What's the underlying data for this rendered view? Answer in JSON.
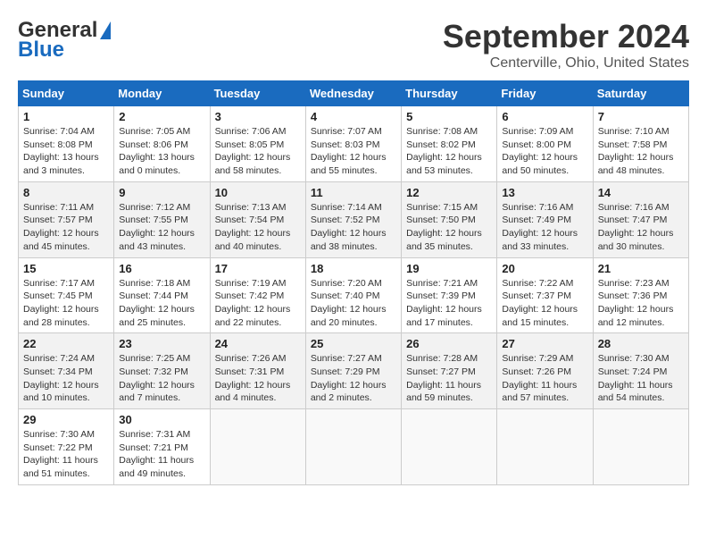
{
  "header": {
    "logo_line1": "General",
    "logo_line2": "Blue",
    "month": "September 2024",
    "location": "Centerville, Ohio, United States"
  },
  "days_of_week": [
    "Sunday",
    "Monday",
    "Tuesday",
    "Wednesday",
    "Thursday",
    "Friday",
    "Saturday"
  ],
  "weeks": [
    [
      {
        "day": "1",
        "sunrise": "Sunrise: 7:04 AM",
        "sunset": "Sunset: 8:08 PM",
        "daylight": "Daylight: 13 hours and 3 minutes."
      },
      {
        "day": "2",
        "sunrise": "Sunrise: 7:05 AM",
        "sunset": "Sunset: 8:06 PM",
        "daylight": "Daylight: 13 hours and 0 minutes."
      },
      {
        "day": "3",
        "sunrise": "Sunrise: 7:06 AM",
        "sunset": "Sunset: 8:05 PM",
        "daylight": "Daylight: 12 hours and 58 minutes."
      },
      {
        "day": "4",
        "sunrise": "Sunrise: 7:07 AM",
        "sunset": "Sunset: 8:03 PM",
        "daylight": "Daylight: 12 hours and 55 minutes."
      },
      {
        "day": "5",
        "sunrise": "Sunrise: 7:08 AM",
        "sunset": "Sunset: 8:02 PM",
        "daylight": "Daylight: 12 hours and 53 minutes."
      },
      {
        "day": "6",
        "sunrise": "Sunrise: 7:09 AM",
        "sunset": "Sunset: 8:00 PM",
        "daylight": "Daylight: 12 hours and 50 minutes."
      },
      {
        "day": "7",
        "sunrise": "Sunrise: 7:10 AM",
        "sunset": "Sunset: 7:58 PM",
        "daylight": "Daylight: 12 hours and 48 minutes."
      }
    ],
    [
      {
        "day": "8",
        "sunrise": "Sunrise: 7:11 AM",
        "sunset": "Sunset: 7:57 PM",
        "daylight": "Daylight: 12 hours and 45 minutes."
      },
      {
        "day": "9",
        "sunrise": "Sunrise: 7:12 AM",
        "sunset": "Sunset: 7:55 PM",
        "daylight": "Daylight: 12 hours and 43 minutes."
      },
      {
        "day": "10",
        "sunrise": "Sunrise: 7:13 AM",
        "sunset": "Sunset: 7:54 PM",
        "daylight": "Daylight: 12 hours and 40 minutes."
      },
      {
        "day": "11",
        "sunrise": "Sunrise: 7:14 AM",
        "sunset": "Sunset: 7:52 PM",
        "daylight": "Daylight: 12 hours and 38 minutes."
      },
      {
        "day": "12",
        "sunrise": "Sunrise: 7:15 AM",
        "sunset": "Sunset: 7:50 PM",
        "daylight": "Daylight: 12 hours and 35 minutes."
      },
      {
        "day": "13",
        "sunrise": "Sunrise: 7:16 AM",
        "sunset": "Sunset: 7:49 PM",
        "daylight": "Daylight: 12 hours and 33 minutes."
      },
      {
        "day": "14",
        "sunrise": "Sunrise: 7:16 AM",
        "sunset": "Sunset: 7:47 PM",
        "daylight": "Daylight: 12 hours and 30 minutes."
      }
    ],
    [
      {
        "day": "15",
        "sunrise": "Sunrise: 7:17 AM",
        "sunset": "Sunset: 7:45 PM",
        "daylight": "Daylight: 12 hours and 28 minutes."
      },
      {
        "day": "16",
        "sunrise": "Sunrise: 7:18 AM",
        "sunset": "Sunset: 7:44 PM",
        "daylight": "Daylight: 12 hours and 25 minutes."
      },
      {
        "day": "17",
        "sunrise": "Sunrise: 7:19 AM",
        "sunset": "Sunset: 7:42 PM",
        "daylight": "Daylight: 12 hours and 22 minutes."
      },
      {
        "day": "18",
        "sunrise": "Sunrise: 7:20 AM",
        "sunset": "Sunset: 7:40 PM",
        "daylight": "Daylight: 12 hours and 20 minutes."
      },
      {
        "day": "19",
        "sunrise": "Sunrise: 7:21 AM",
        "sunset": "Sunset: 7:39 PM",
        "daylight": "Daylight: 12 hours and 17 minutes."
      },
      {
        "day": "20",
        "sunrise": "Sunrise: 7:22 AM",
        "sunset": "Sunset: 7:37 PM",
        "daylight": "Daylight: 12 hours and 15 minutes."
      },
      {
        "day": "21",
        "sunrise": "Sunrise: 7:23 AM",
        "sunset": "Sunset: 7:36 PM",
        "daylight": "Daylight: 12 hours and 12 minutes."
      }
    ],
    [
      {
        "day": "22",
        "sunrise": "Sunrise: 7:24 AM",
        "sunset": "Sunset: 7:34 PM",
        "daylight": "Daylight: 12 hours and 10 minutes."
      },
      {
        "day": "23",
        "sunrise": "Sunrise: 7:25 AM",
        "sunset": "Sunset: 7:32 PM",
        "daylight": "Daylight: 12 hours and 7 minutes."
      },
      {
        "day": "24",
        "sunrise": "Sunrise: 7:26 AM",
        "sunset": "Sunset: 7:31 PM",
        "daylight": "Daylight: 12 hours and 4 minutes."
      },
      {
        "day": "25",
        "sunrise": "Sunrise: 7:27 AM",
        "sunset": "Sunset: 7:29 PM",
        "daylight": "Daylight: 12 hours and 2 minutes."
      },
      {
        "day": "26",
        "sunrise": "Sunrise: 7:28 AM",
        "sunset": "Sunset: 7:27 PM",
        "daylight": "Daylight: 11 hours and 59 minutes."
      },
      {
        "day": "27",
        "sunrise": "Sunrise: 7:29 AM",
        "sunset": "Sunset: 7:26 PM",
        "daylight": "Daylight: 11 hours and 57 minutes."
      },
      {
        "day": "28",
        "sunrise": "Sunrise: 7:30 AM",
        "sunset": "Sunset: 7:24 PM",
        "daylight": "Daylight: 11 hours and 54 minutes."
      }
    ],
    [
      {
        "day": "29",
        "sunrise": "Sunrise: 7:30 AM",
        "sunset": "Sunset: 7:22 PM",
        "daylight": "Daylight: 11 hours and 51 minutes."
      },
      {
        "day": "30",
        "sunrise": "Sunrise: 7:31 AM",
        "sunset": "Sunset: 7:21 PM",
        "daylight": "Daylight: 11 hours and 49 minutes."
      },
      null,
      null,
      null,
      null,
      null
    ]
  ]
}
